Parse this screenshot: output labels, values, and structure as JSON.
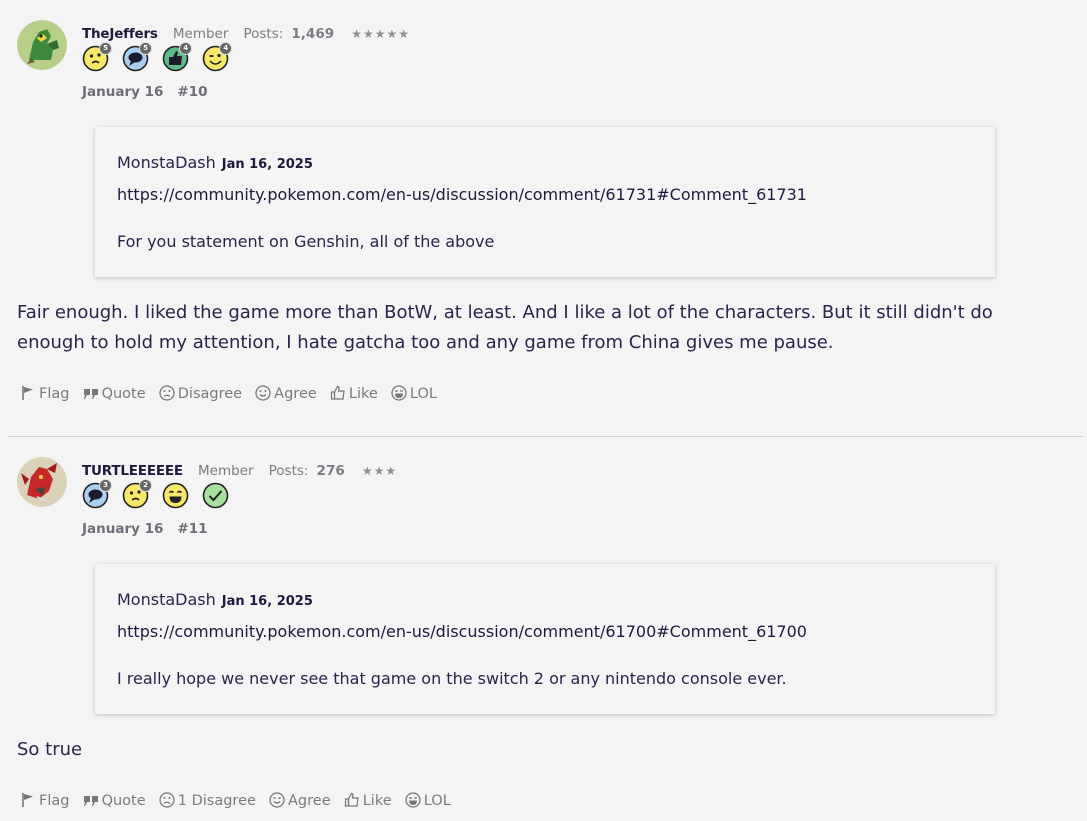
{
  "posts": [
    {
      "username": "TheJeffers",
      "role": "Member",
      "posts_label": "Posts:",
      "posts_count": "1,469",
      "stars": "★★★★★",
      "badges": [
        {
          "icon": "confused-face-badge-icon",
          "count": "5"
        },
        {
          "icon": "speech-bubble-badge-icon",
          "count": "5"
        },
        {
          "icon": "thumbs-up-badge-icon",
          "count": "4"
        },
        {
          "icon": "winking-face-badge-icon",
          "count": "4"
        }
      ],
      "date": "January 16",
      "post_number": "#10",
      "quote": {
        "author": "MonstaDash",
        "date": "Jan 16, 2025",
        "link": "https://community.pokemon.com/en-us/discussion/comment/61731#Comment_61731",
        "text": "For you statement on Genshin, all of the above"
      },
      "body": "Fair enough. I liked the game more than BotW, at least. And I like a lot of the characters. But it still didn't do enough to hold my attention, I hate gatcha too and any game from China gives me pause.",
      "actions": {
        "flag": "Flag",
        "quote": "Quote",
        "disagree": "Disagree",
        "agree": "Agree",
        "like": "Like",
        "lol": "LOL"
      }
    },
    {
      "username": "TURTLEEEEEE",
      "role": "Member",
      "posts_label": "Posts:",
      "posts_count": "276",
      "stars": "★★★",
      "badges": [
        {
          "icon": "speech-bubble-badge-icon",
          "count": "3"
        },
        {
          "icon": "confused-face-badge-icon",
          "count": "2"
        },
        {
          "icon": "grinning-face-badge-icon",
          "count": ""
        },
        {
          "icon": "checkmark-badge-icon",
          "count": ""
        }
      ],
      "date": "January 16",
      "post_number": "#11",
      "quote": {
        "author": "MonstaDash",
        "date": "Jan 16, 2025",
        "link": "https://community.pokemon.com/en-us/discussion/comment/61700#Comment_61700",
        "text": "I really hope we never see that game on the switch 2 or any nintendo console ever."
      },
      "body": "So true",
      "actions": {
        "flag": "Flag",
        "quote": "Quote",
        "disagree": "1 Disagree",
        "agree": "Agree",
        "like": "Like",
        "lol": "LOL"
      }
    }
  ]
}
